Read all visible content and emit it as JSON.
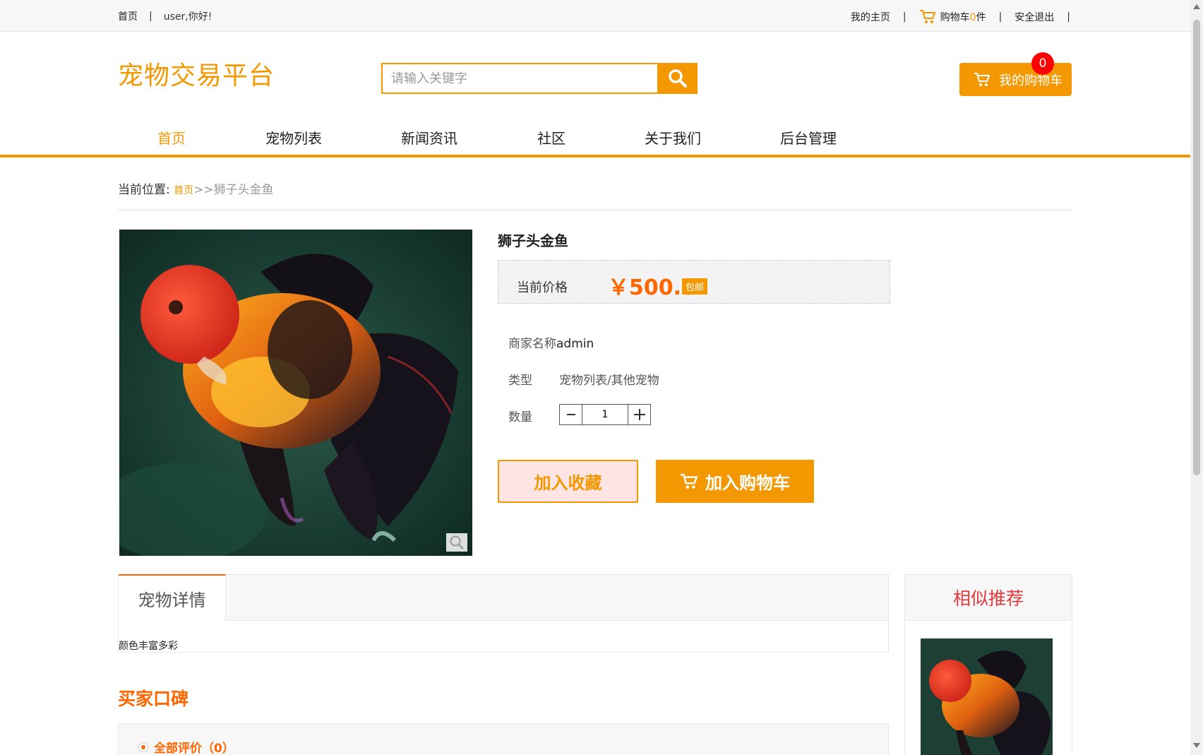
{
  "topbar": {
    "home": "首页",
    "greeting": "user,你好!",
    "my_home": "我的主页",
    "cart_label": "购物车",
    "cart_count": "0",
    "cart_unit": "件",
    "logout": "安全退出",
    "sep": "|"
  },
  "header": {
    "logo": "宠物交易平台",
    "search_placeholder": "请输入关键字",
    "my_cart": "我的购物车",
    "cart_badge": "0"
  },
  "nav": {
    "items": [
      "首页",
      "宠物列表",
      "新闻资讯",
      "社区",
      "关于我们",
      "后台管理"
    ]
  },
  "breadcrumb": {
    "label": "当前位置:",
    "home": "首页",
    "sep": ">>",
    "current": "狮子头金鱼"
  },
  "product": {
    "title": "狮子头金鱼",
    "price_label": "当前价格",
    "price": "￥500.0",
    "free_shipping": "包邮",
    "merchant_label": "商家名称",
    "merchant": "admin",
    "type_label": "类型",
    "type": "宠物列表/其他宠物",
    "qty_label": "数量",
    "qty": "1",
    "fav_button": "加入收藏",
    "cart_button": "加入购物车"
  },
  "detail": {
    "tab": "宠物详情",
    "text": "颜色丰富多彩"
  },
  "reviews": {
    "title": "买家口碑",
    "all": "全部评价（0）"
  },
  "similar": {
    "title": "相似推荐"
  },
  "colors": {
    "accent": "#f39800",
    "price": "#ff6600",
    "badge": "#ff0000",
    "similar_title": "#e4393c"
  }
}
